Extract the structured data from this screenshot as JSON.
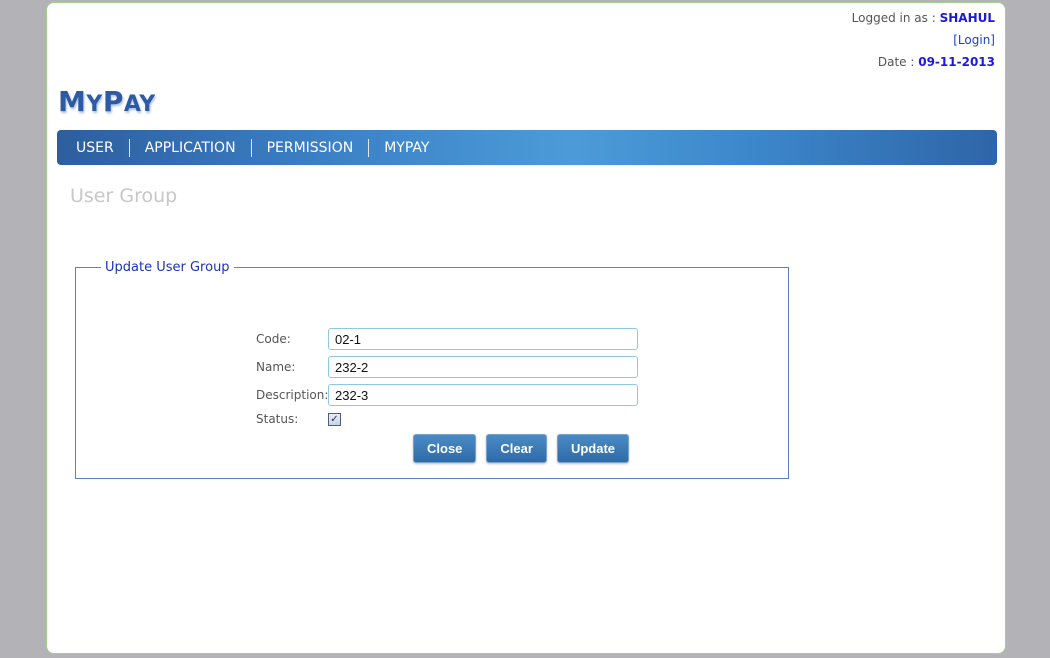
{
  "header": {
    "logged_in_prefix": "Logged in as :",
    "username": "SHAHUL",
    "login_link": "[Login]",
    "date_prefix": "Date :",
    "date": "09-11-2013"
  },
  "logo": {
    "first_initial": "M",
    "first_rest": "Y",
    "second_initial": "P",
    "second_rest": "AY"
  },
  "nav": {
    "items": [
      {
        "label": "USER"
      },
      {
        "label": "APPLICATION"
      },
      {
        "label": "PERMISSION"
      },
      {
        "label": "MYPAY"
      }
    ]
  },
  "page_title": "User Group",
  "form": {
    "legend": "Update User Group",
    "code_label": "Code:",
    "code_value": "02-1",
    "name_label": "Name:",
    "name_value": "232-2",
    "description_label": "Description:",
    "description_value": "232-3",
    "status_label": "Status:",
    "status_checked": true,
    "checkmark": "✓",
    "close_label": "Close",
    "clear_label": "Clear",
    "update_label": "Update"
  },
  "colors": {
    "accent": "#1a1ad8",
    "nav_bar": "#3c82c7",
    "button": "#2e6aa8"
  }
}
